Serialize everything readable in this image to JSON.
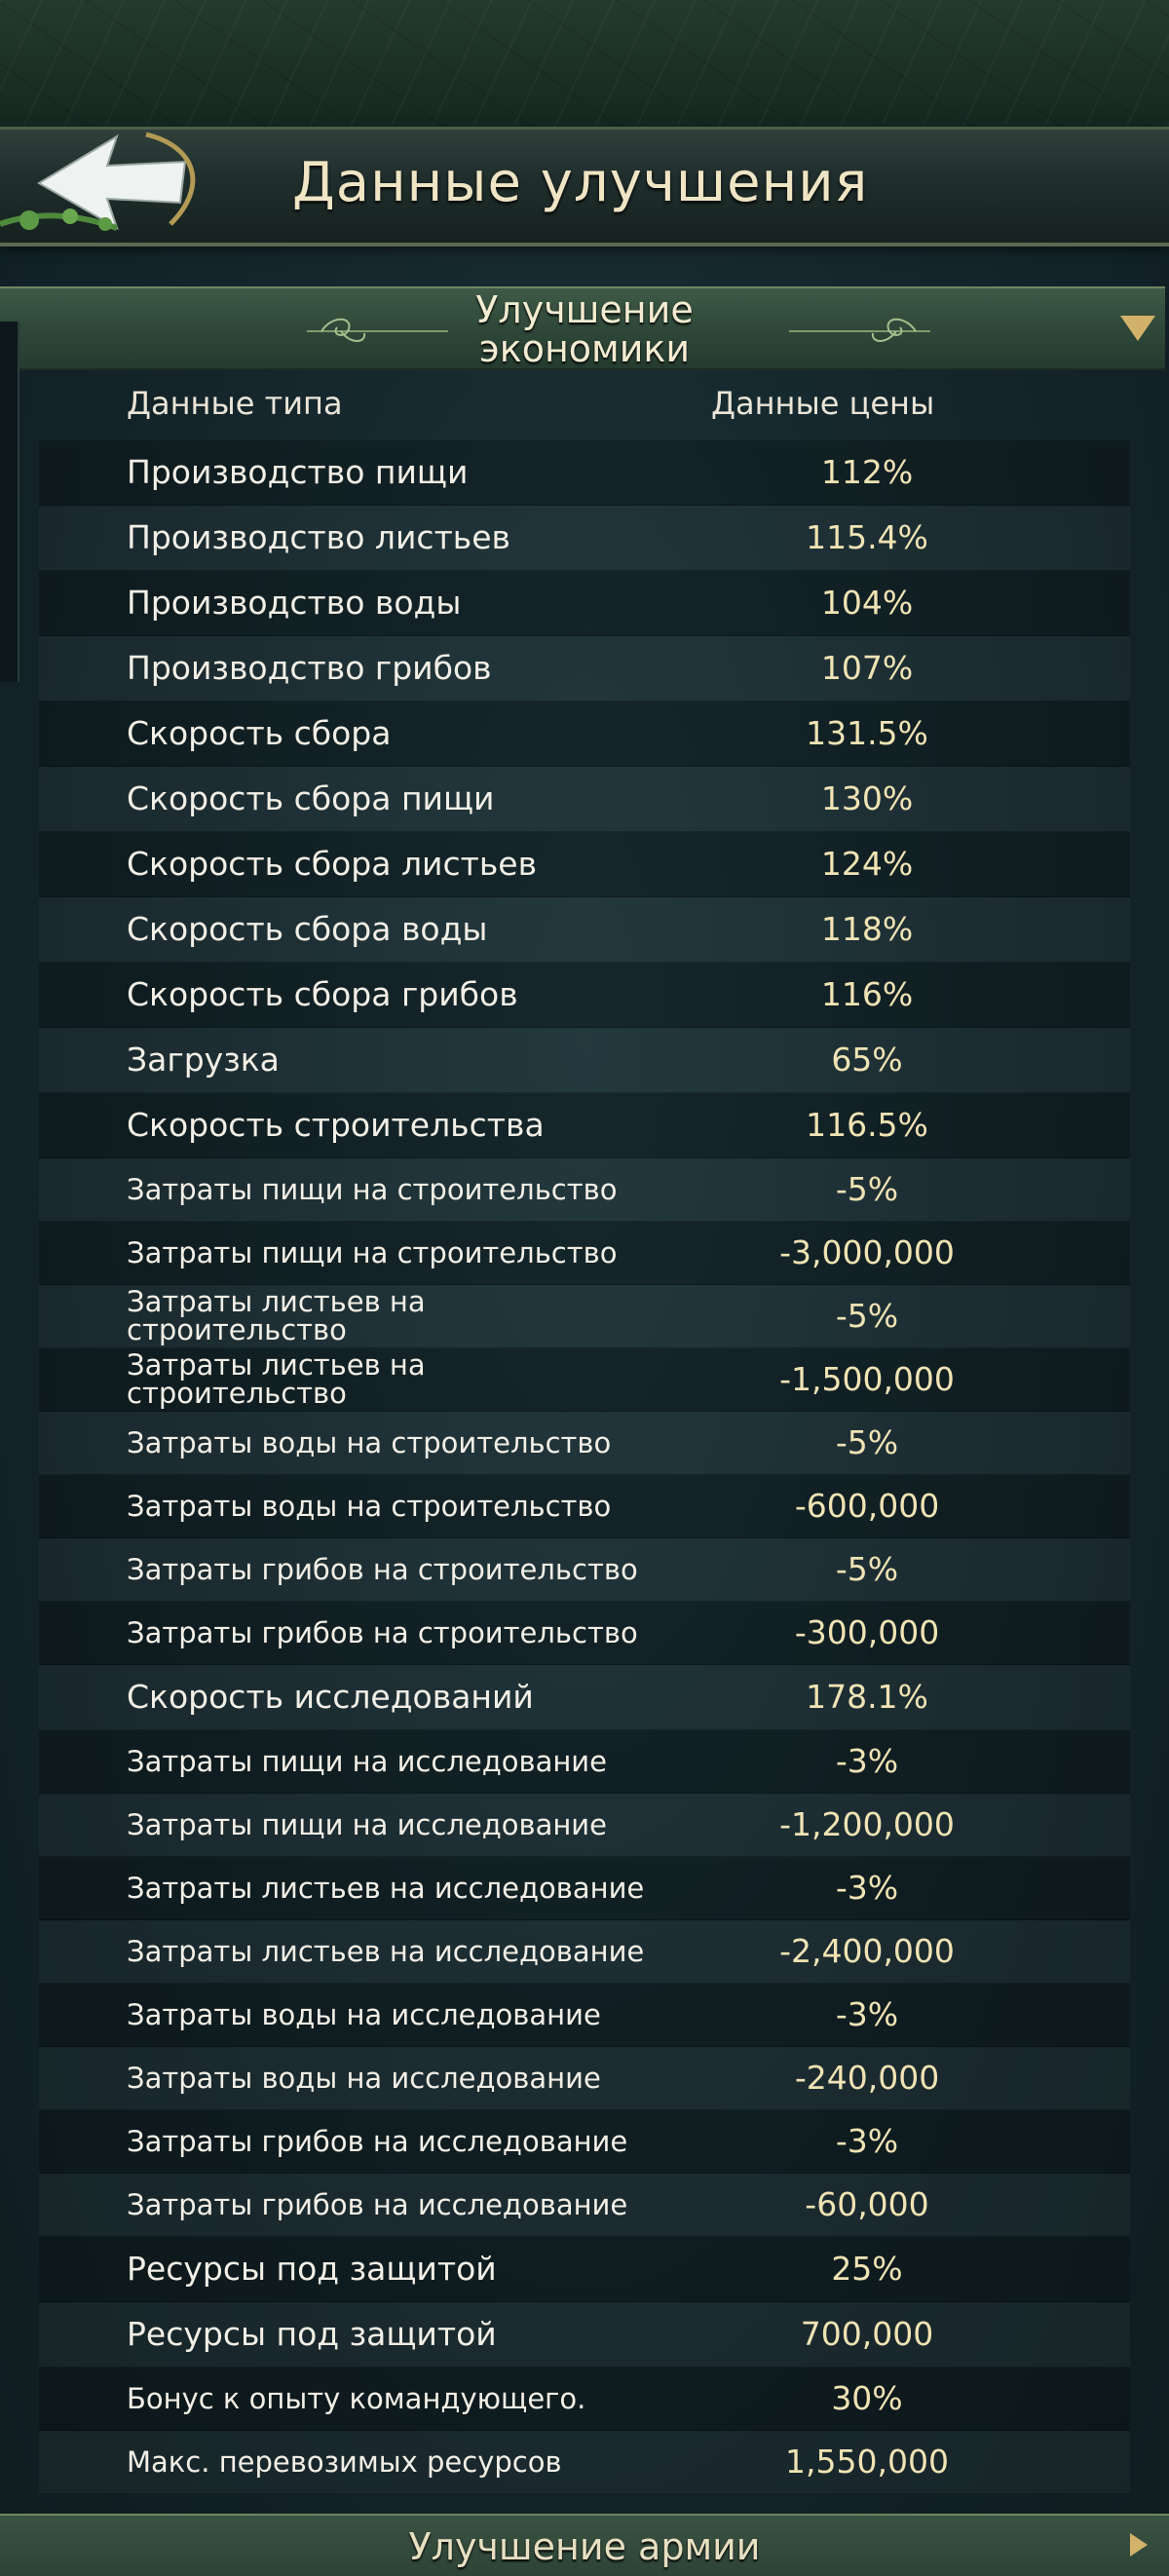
{
  "header": {
    "title": "Данные улучшения"
  },
  "section": {
    "title": "Улучшение экономики"
  },
  "columns": {
    "type": "Данные типа",
    "price": "Данные цены"
  },
  "rows": [
    {
      "label": "Производство пищи",
      "value": "112%"
    },
    {
      "label": "Производство листьев",
      "value": "115.4%"
    },
    {
      "label": "Производство воды",
      "value": "104%"
    },
    {
      "label": "Производство грибов",
      "value": "107%"
    },
    {
      "label": "Скорость сбора",
      "value": "131.5%"
    },
    {
      "label": "Скорость сбора пищи",
      "value": "130%"
    },
    {
      "label": "Скорость сбора листьев",
      "value": "124%"
    },
    {
      "label": "Скорость сбора воды",
      "value": "118%"
    },
    {
      "label": "Скорость сбора грибов",
      "value": "116%"
    },
    {
      "label": "Загрузка",
      "value": "65%"
    },
    {
      "label": "Скорость строительства",
      "value": "116.5%"
    },
    {
      "label": "Затраты пищи на строительство",
      "value": "-5%"
    },
    {
      "label": "Затраты пищи на строительство",
      "value": "-3,000,000"
    },
    {
      "label": "Затраты листьев на строительство",
      "value": "-5%"
    },
    {
      "label": "Затраты листьев на строительство",
      "value": "-1,500,000"
    },
    {
      "label": "Затраты воды на строительство",
      "value": "-5%"
    },
    {
      "label": "Затраты воды на строительство",
      "value": "-600,000"
    },
    {
      "label": "Затраты грибов на строительство",
      "value": "-5%"
    },
    {
      "label": "Затраты грибов на строительство",
      "value": "-300,000"
    },
    {
      "label": "Скорость исследований",
      "value": "178.1%"
    },
    {
      "label": "Затраты пищи на исследование",
      "value": "-3%"
    },
    {
      "label": "Затраты пищи на исследование",
      "value": "-1,200,000"
    },
    {
      "label": "Затраты листьев на исследование",
      "value": "-3%"
    },
    {
      "label": "Затраты листьев на исследование",
      "value": "-2,400,000"
    },
    {
      "label": "Затраты воды на исследование",
      "value": "-3%"
    },
    {
      "label": "Затраты воды на исследование",
      "value": "-240,000"
    },
    {
      "label": "Затраты грибов на исследование",
      "value": "-3%"
    },
    {
      "label": "Затраты грибов на исследование",
      "value": "-60,000"
    },
    {
      "label": "Ресурсы под защитой",
      "value": "25%"
    },
    {
      "label": "Ресурсы под защитой",
      "value": "700,000"
    },
    {
      "label": "Бонус к опыту командующего.",
      "value": "30%"
    },
    {
      "label": "Макс. перевозимых ресурсов",
      "value": "1,550,000"
    }
  ],
  "footer": {
    "title": "Улучшение армии"
  },
  "colors": {
    "value_text": "#f0e3b4",
    "label_text": "#f2efe6",
    "accent_gold": "#d2b26a",
    "section_green": "#2f4839"
  }
}
